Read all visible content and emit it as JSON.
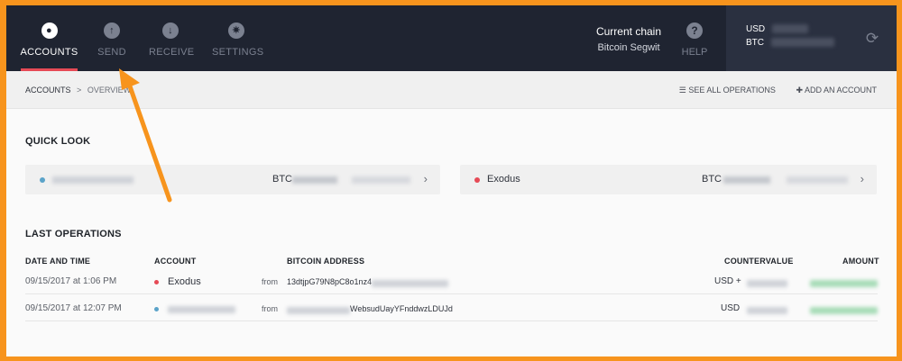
{
  "nav": {
    "items": [
      {
        "label": "ACCOUNTS",
        "icon": "users-icon",
        "active": true
      },
      {
        "label": "SEND",
        "icon": "arrow-up-icon",
        "active": false
      },
      {
        "label": "RECEIVE",
        "icon": "arrow-down-icon",
        "active": false
      },
      {
        "label": "SETTINGS",
        "icon": "gear-icon",
        "active": false
      }
    ],
    "chain_label": "Current chain",
    "chain_value": "Bitcoin Segwit",
    "help_label": "HELP",
    "help_icon": "?",
    "balance": {
      "usd_label": "USD",
      "btc_label": "BTC"
    }
  },
  "subheader": {
    "breadcrumb_root": "ACCOUNTS",
    "breadcrumb_sep": ">",
    "breadcrumb_current": "OVERVIEW",
    "see_all": "SEE ALL OPERATIONS",
    "add_account": "ADD AN ACCOUNT"
  },
  "quick_look": {
    "title": "QUICK LOOK",
    "cards": [
      {
        "name": "",
        "currency": "BTC",
        "dot_color": "#5ba3c9"
      },
      {
        "name": "Exodus",
        "currency": "BTC",
        "dot_color": "#e64a56"
      }
    ]
  },
  "operations": {
    "title": "LAST OPERATIONS",
    "headers": {
      "date": "DATE AND TIME",
      "account": "ACCOUNT",
      "address": "BITCOIN ADDRESS",
      "countervalue": "COUNTERVALUE",
      "amount": "AMOUNT"
    },
    "rows": [
      {
        "date": "09/15/2017 at 1:06 PM",
        "account": "Exodus",
        "dot_color": "#e64a56",
        "direction": "from",
        "address": "13dtjpG79N8pC8o1nz4",
        "countervalue": "USD +"
      },
      {
        "date": "09/15/2017 at 12:07 PM",
        "account": "",
        "dot_color": "#5ba3c9",
        "direction": "from",
        "address": "WebsudUayYFnddwzLDUJd",
        "countervalue": "USD"
      }
    ]
  },
  "colors": {
    "accent": "#e64a56",
    "topbar": "#1f2431",
    "positive": "#3cb371"
  }
}
